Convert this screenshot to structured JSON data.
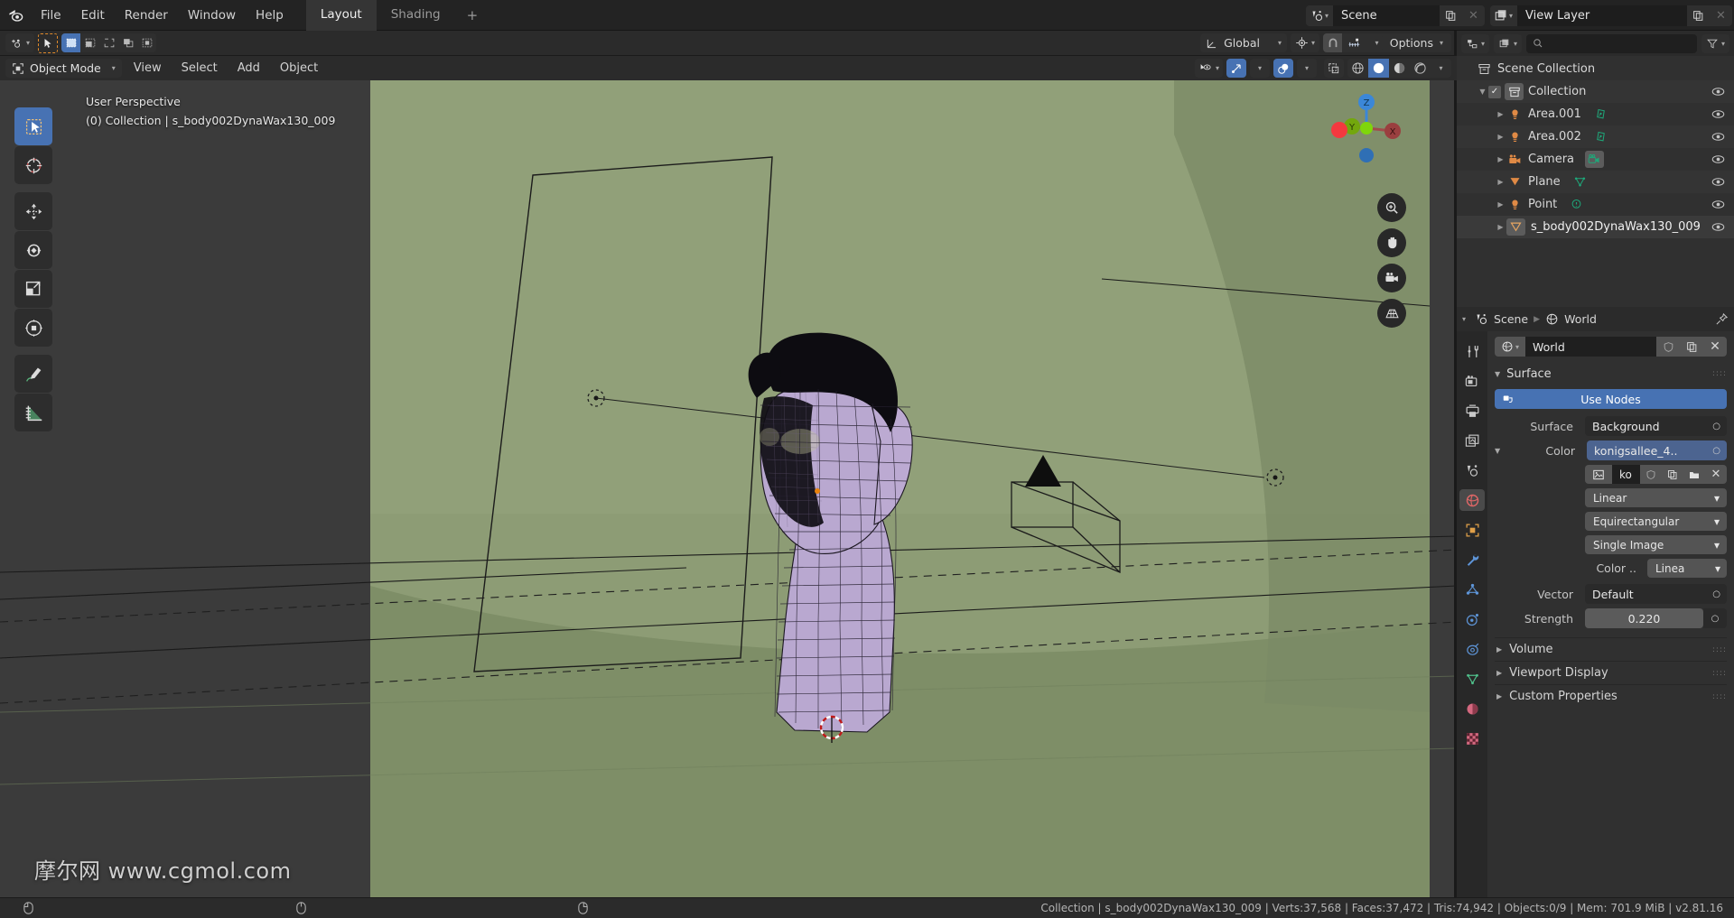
{
  "app": {
    "title": "Blender",
    "version": "v2.81.16"
  },
  "topbar": {
    "logo_icon": "blender-logo-icon",
    "menus": [
      "File",
      "Edit",
      "Render",
      "Window",
      "Help"
    ],
    "workspaces": [
      {
        "label": "Layout",
        "active": true
      },
      {
        "label": "Shading",
        "active": false
      }
    ],
    "add_workspace_label": "+",
    "scene_selector": {
      "icon": "scene-icon",
      "value": "Scene",
      "new_icon": "duplicate-icon",
      "remove_icon": "close-icon"
    },
    "viewlayer_selector": {
      "icon": "view-layer-icon",
      "value": "View Layer",
      "new_icon": "duplicate-icon",
      "remove_icon": "close-icon"
    }
  },
  "tool_header": {
    "cursor_tool_icon": "add-cursor-icon",
    "select_tool_icon": "select-box-icon",
    "select_modes": [
      "set-icon",
      "extend-icon",
      "subtract-icon",
      "invert-icon",
      "intersect-icon"
    ],
    "transform_orientation": {
      "icon": "orientation-icon",
      "value": "Global"
    },
    "pivot_point_icon": "pivot-icon",
    "snap_magnet_icon": "magnet-icon",
    "snap_target_icon": "snap-increment-icon",
    "proportional_edit_icon": "proportional-edit-icon",
    "falloff_icon": "smooth-falloff-icon",
    "options_label": "Options"
  },
  "viewport": {
    "mode": "Object Mode",
    "mode_icon": "object-mode-icon",
    "menus": [
      "View",
      "Select",
      "Add",
      "Object"
    ],
    "overlay_line1": "User Perspective",
    "overlay_line2": "(0) Collection | s_body002DynaWax130_009",
    "watermark": "摩尔网 www.cgmol.com",
    "tools": [
      {
        "name": "tweak-select-tool",
        "icon": "select-box-icon",
        "active": true
      },
      {
        "name": "cursor-tool",
        "icon": "cursor-3d-icon",
        "active": false
      },
      {
        "name": "move-tool",
        "icon": "move-icon",
        "active": false
      },
      {
        "name": "rotate-tool",
        "icon": "rotate-icon",
        "active": false
      },
      {
        "name": "scale-tool",
        "icon": "scale-icon",
        "active": false
      },
      {
        "name": "transform-tool",
        "icon": "transform-icon",
        "active": false
      },
      {
        "name": "annotate-tool",
        "icon": "annotate-pencil-icon",
        "active": false
      },
      {
        "name": "measure-tool",
        "icon": "measure-ruler-icon",
        "active": false
      }
    ],
    "header_right": {
      "visibility_icon": "eye-dropdown-icon",
      "gizmo_icon": "gizmo-icon",
      "gizmo_on": true,
      "overlays_icon": "overlays-icon",
      "overlays_on": true,
      "xray_icon": "xray-toggle-icon",
      "shading_modes": [
        {
          "name": "wireframe-shading",
          "icon": "wireframe-globe-icon",
          "active": false
        },
        {
          "name": "solid-shading",
          "icon": "solid-sphere-icon",
          "active": true
        },
        {
          "name": "material-preview-shading",
          "icon": "material-sphere-icon",
          "active": false
        },
        {
          "name": "rendered-shading",
          "icon": "rendered-sphere-icon",
          "active": false
        }
      ]
    },
    "gizmo_axes": [
      {
        "label": "Z",
        "color": "#3b87d8"
      },
      {
        "label": "Y",
        "color": "#73a70d"
      },
      {
        "label": "X",
        "color": "#cf4b4b"
      }
    ],
    "nav_buttons": [
      {
        "name": "zoom-button",
        "icon": "zoom-in-icon"
      },
      {
        "name": "pan-button",
        "icon": "hand-icon"
      },
      {
        "name": "camera-view-button",
        "icon": "camera-icon"
      },
      {
        "name": "toggle-projection-button",
        "icon": "grid-perspective-icon"
      }
    ],
    "scene_colors": {
      "backdrop": "#8a9a72",
      "floor": "#7e8e67",
      "model": "#b9a8d0",
      "model_dark": "#0e0d10",
      "wire": "#171420",
      "outline_selected": "#e87d0d"
    }
  },
  "outliner": {
    "header": {
      "display_mode_icon": "outliner-display-icon",
      "filter_id_icon": "filter-id-icon",
      "search_icon": "search-icon",
      "search_placeholder": "",
      "filter_icon": "funnel-icon"
    },
    "root": {
      "label": "Scene Collection",
      "icon": "scene-collection-icon"
    },
    "items": [
      {
        "label": "Collection",
        "icon": "collection-icon",
        "indent": 1,
        "checkbox": true,
        "expand": "down",
        "highlight": true,
        "eye": true
      },
      {
        "label": "Area.001",
        "icon": "light-icon",
        "data_icon": "light-area-data-icon",
        "indent": 2,
        "expand": "right",
        "eye": true
      },
      {
        "label": "Area.002",
        "icon": "light-icon",
        "data_icon": "light-area-data-icon",
        "indent": 2,
        "expand": "right",
        "eye": true
      },
      {
        "label": "Camera",
        "icon": "camera-obj-icon",
        "data_icon": "camera-data-icon",
        "data_highlight": true,
        "indent": 2,
        "expand": "right",
        "eye": true
      },
      {
        "label": "Plane",
        "icon": "mesh-icon",
        "data_icon": "mesh-data-icon",
        "indent": 2,
        "expand": "right",
        "eye": true
      },
      {
        "label": "Point",
        "icon": "light-icon",
        "data_icon": "light-point-data-icon",
        "indent": 2,
        "expand": "right",
        "eye": true
      },
      {
        "label": "s_body002DynaWax130_009",
        "icon": "mesh-icon",
        "icon_highlight": true,
        "indent": 2,
        "expand": "right",
        "eye": true,
        "selected": true
      }
    ]
  },
  "properties": {
    "breadcrumb": [
      {
        "label": "Scene",
        "icon": "scene-icon"
      },
      {
        "label": "World",
        "icon": "world-icon"
      }
    ],
    "pin_icon": "pin-icon",
    "tabs": [
      {
        "name": "tool",
        "icon": "tool-icon",
        "color": "#c9c9c9",
        "active": false
      },
      {
        "name": "render",
        "icon": "render-camera-icon",
        "color": "#c9c9c9",
        "active": false
      },
      {
        "name": "output",
        "icon": "output-printer-icon",
        "color": "#c9c9c9",
        "active": false
      },
      {
        "name": "view-layer",
        "icon": "view-layer-images-icon",
        "color": "#c9c9c9",
        "active": false
      },
      {
        "name": "scene",
        "icon": "scene-cone-icon",
        "color": "#c9c9c9",
        "active": false
      },
      {
        "name": "world",
        "icon": "world-globe-icon",
        "color": "#e06767",
        "active": true
      },
      {
        "name": "object",
        "icon": "object-square-icon",
        "color": "#e0a049",
        "active": false
      },
      {
        "name": "modifiers",
        "icon": "wrench-icon",
        "color": "#5e95d8",
        "active": false
      },
      {
        "name": "particles",
        "icon": "particles-icon",
        "color": "#5e95d8",
        "active": false
      },
      {
        "name": "physics",
        "icon": "physics-orbit-icon",
        "color": "#5e95d8",
        "active": false
      },
      {
        "name": "constraints",
        "icon": "constraints-icon",
        "color": "#5e95d8",
        "active": false
      },
      {
        "name": "object-data",
        "icon": "mesh-data-triangle-icon",
        "color": "#4fbf8a",
        "active": false
      },
      {
        "name": "material",
        "icon": "material-sphere-icon",
        "color": "#d4687f",
        "active": false
      },
      {
        "name": "texture",
        "icon": "texture-checker-icon",
        "color": "#d4687f",
        "active": false
      }
    ],
    "world_id": {
      "browse_icon": "world-browse-icon",
      "name": "World",
      "fake_user_icon": "shield-icon",
      "new_icon": "duplicate-icon",
      "unlink_icon": "close-icon"
    },
    "surface_panel": {
      "title": "Surface",
      "expanded": true,
      "use_nodes_label": "Use Nodes",
      "use_nodes_icon": "nodes-icon",
      "rows": [
        {
          "label": "Surface",
          "value": "Background",
          "type": "dropdown-socket"
        },
        {
          "label": "Color",
          "value": "konigsallee_4..",
          "type": "socket-linked",
          "expand": true
        }
      ],
      "image_id": {
        "image_icon": "image-icon",
        "name": "ko",
        "fake_user_icon": "shield-icon",
        "copy_icon": "duplicate-icon",
        "open_icon": "folder-icon",
        "unlink_icon": "close-icon"
      },
      "image_options": [
        {
          "value": "Linear",
          "type": "dropdown"
        },
        {
          "value": "Equirectangular",
          "type": "dropdown"
        },
        {
          "value": "Single Image",
          "type": "dropdown"
        }
      ],
      "colorspace": {
        "label": "Color ..",
        "value": "Linea"
      },
      "vector_row": {
        "label": "Vector",
        "value": "Default"
      },
      "strength_row": {
        "label": "Strength",
        "value": "0.220"
      }
    },
    "collapsed_panels": [
      {
        "label": "Volume"
      },
      {
        "label": "Viewport Display"
      },
      {
        "label": "Custom Properties"
      }
    ]
  },
  "statusbar": {
    "mouse_hints": [
      "select-icon",
      "menu-icon",
      "menu-icon"
    ],
    "stats": "Collection | s_body002DynaWax130_009 | Verts:37,568 | Faces:37,472 | Tris:74,942 | Objects:0/9 | Mem: 701.9 MiB | v2.81.16"
  }
}
